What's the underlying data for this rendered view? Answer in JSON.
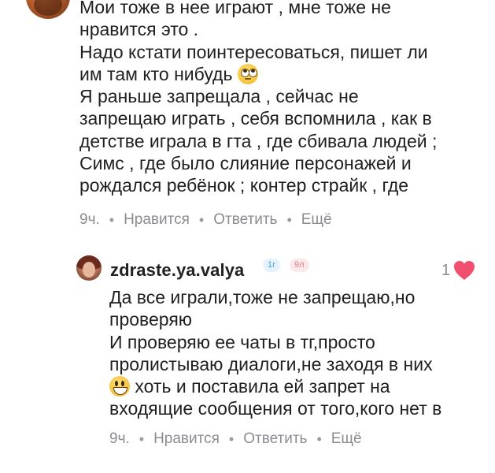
{
  "thread": {
    "parent_comment": {
      "text_line1": "Мои тоже в нее играют , мне тоже не\nнравится это .\nНадо кстати поинтересоваться, пишет ли\nим там кто нибудь ",
      "text_line2": "\nЯ раньше запрещала , сейчас не\nзапрещаю играть , себя вспомнила , как в\nдетстве играла в гта , где сбивала людей ;\nСимс , где было слияние персонажей и\nрождался ребёнок ; контер страйк , где",
      "emoji": "face-with-rolling-eyes-emoji",
      "time": "9ч.",
      "like_label": "Нравится",
      "reply_label": "Ответить",
      "more_label": "Ещё"
    },
    "reply": {
      "username": "zdraste.ya.valya",
      "badges": [
        "1г",
        "9л"
      ],
      "likes": "1",
      "text_line1": "Да все играли,тоже не запрещаю,но\nпроверяю\nИ проверяю ее чаты в тг,просто\nпролистываю диалоги,не заходя в них\n",
      "text_line2": "хоть и поставила ей запрет на\nвходящие сообщения от того,кого нет в",
      "emoji": "grinning-face-emoji",
      "time": "9ч.",
      "like_label": "Нравится",
      "reply_label": "Ответить",
      "more_label": "Ещё"
    }
  },
  "colors": {
    "text": "#1f1f1f",
    "meta": "#8b8b93",
    "heart": "#f0506e",
    "badge_blue_bg": "#e6f2fb",
    "badge_blue_text": "#4aa3dd",
    "badge_pink_bg": "#fbe8ea",
    "badge_pink_text": "#e07a85"
  }
}
